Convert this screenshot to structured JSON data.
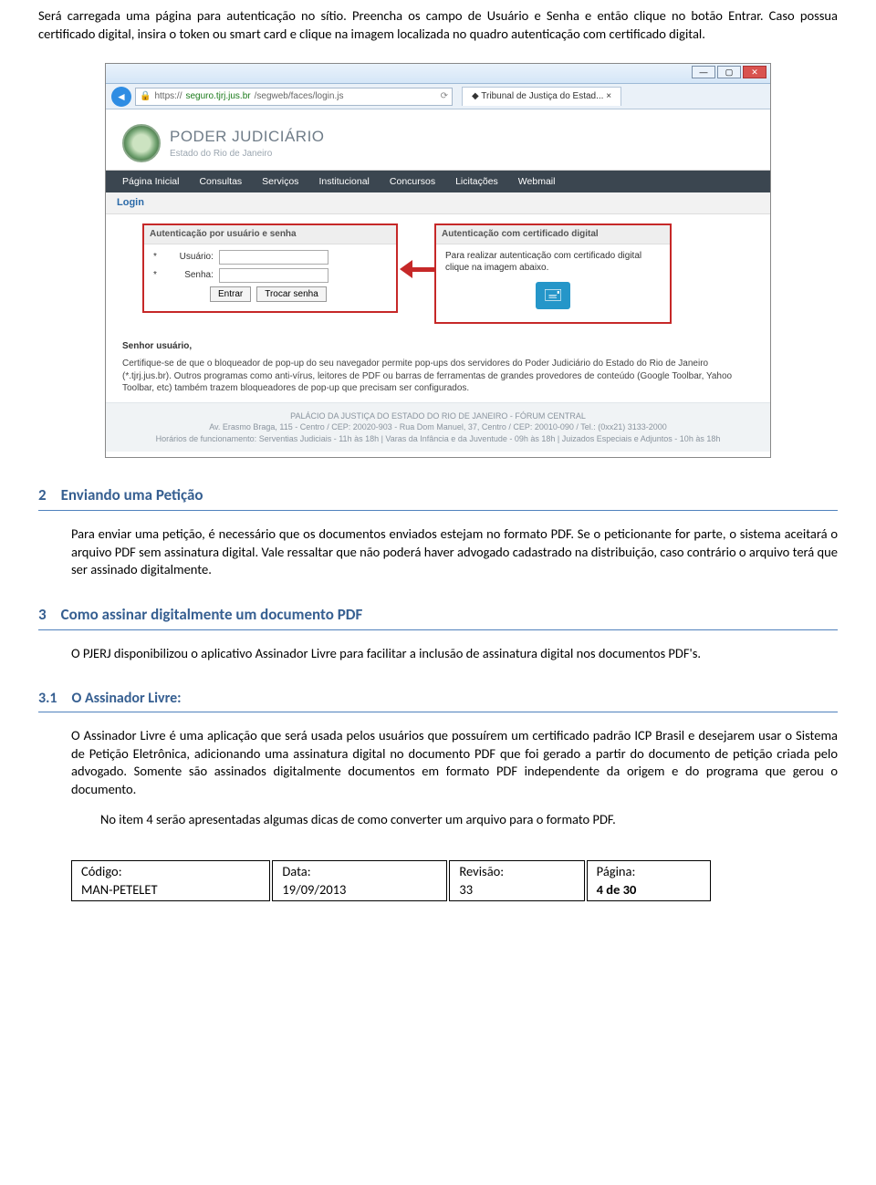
{
  "intro": {
    "p1": "Será carregada uma página para autenticação no sítio. Preencha os campo de Usuário e Senha e então clique no botão Entrar. Caso possua certificado digital, insira o token ou smart card e clique na imagem localizada no quadro autenticação com certificado digital."
  },
  "browser": {
    "url_prefix": "https://",
    "url_host": "seguro.tjrj.jus.br",
    "url_path": "/segweb/faces/login.js",
    "tab_title": "Tribunal de Justiça do Estad...",
    "pj_title": "PODER JUDICIÁRIO",
    "pj_subtitle": "Estado do Rio de Janeiro",
    "menu": [
      "Página Inicial",
      "Consultas",
      "Serviços",
      "Institucional",
      "Concursos",
      "Licitações",
      "Webmail"
    ],
    "login_label": "Login",
    "box_left_title": "Autenticação por usuário e senha",
    "lbl_user": "Usuário:",
    "lbl_pass": "Senha:",
    "btn_entrar": "Entrar",
    "btn_trocar": "Trocar senha",
    "box_right_title": "Autenticação com certificado digital",
    "cert_text": "Para realizar autenticação com certificado digital clique na imagem abaixo.",
    "notice_greet": "Senhor usuário,",
    "notice_msg": "Certifique-se de que o bloqueador de pop-up do seu navegador permite pop-ups dos servidores do Poder Judiciário do Estado do Rio de Janeiro (*.tjrj.jus.br). Outros programas como anti-vírus, leitores de PDF ou barras de ferramentas de grandes provedores de conteúdo (Google Toolbar, Yahoo Toolbar, etc) também trazem bloqueadores de pop-up que precisam ser configurados.",
    "footer_l1": "PALÁCIO DA JUSTIÇA DO ESTADO DO RIO DE JANEIRO - FÓRUM CENTRAL",
    "footer_l2": "Av. Erasmo Braga, 115 - Centro / CEP: 20020-903 - Rua Dom Manuel, 37, Centro / CEP: 20010-090 / Tel.: (0xx21) 3133-2000",
    "footer_l3": "Horários de funcionamento: Serventias Judiciais - 11h às 18h | Varas da Infância e da Juventude - 09h às 18h | Juizados Especiais e Adjuntos - 10h às 18h"
  },
  "sec2": {
    "num": "2",
    "title": "Enviando uma Petição",
    "body": "Para enviar uma petição, é necessário que os documentos enviados estejam no formato PDF. Se o peticionante for parte, o sistema aceitará o arquivo PDF sem assinatura digital. Vale ressaltar que não poderá haver advogado cadastrado na distribuição, caso contrário o arquivo terá que ser assinado digitalmente."
  },
  "sec3": {
    "num": "3",
    "title": "Como assinar digitalmente um documento PDF",
    "body": "O PJERJ disponibilizou o aplicativo Assinador Livre para facilitar a inclusão de assinatura digital nos documentos PDF's."
  },
  "sec31": {
    "num": "3.1",
    "title": "O Assinador Livre:",
    "body": "O Assinador Livre é uma aplicação que será usada pelos usuários que possuírem um certificado padrão ICP Brasil e desejarem usar o Sistema de Petição Eletrônica, adicionando uma assinatura digital no documento PDF que foi gerado a partir do documento de petição criada pelo advogado. Somente são assinados digitalmente documentos em formato PDF independente da origem e do programa que gerou o documento.",
    "body2": "No item 4 serão apresentadas algumas dicas de como converter um arquivo para o formato PDF."
  },
  "footer": {
    "codigo_lbl": "Código:",
    "codigo_val": "MAN-PETELET",
    "data_lbl": "Data:",
    "data_val": "19/09/2013",
    "rev_lbl": "Revisão:",
    "rev_val": "33",
    "pag_lbl": "Página:",
    "pag_val": "4 de 30"
  }
}
